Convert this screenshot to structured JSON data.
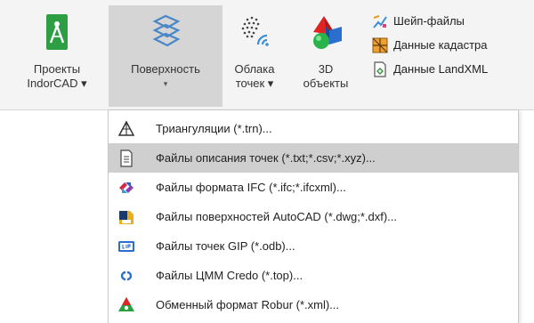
{
  "ribbon": {
    "projects": {
      "line1": "Проекты",
      "line2": "IndorCAD ▾",
      "icon": "compass-icon",
      "color": "#2e9e44"
    },
    "surface": {
      "line1": "Поверхность",
      "arrow": "▾",
      "icon": "layers-icon",
      "active": true
    },
    "cloud": {
      "line1": "Облака",
      "line2": "точек ▾",
      "icon": "point-cloud-icon"
    },
    "objects3d": {
      "line1": "3D",
      "line2": "объекты",
      "icon": "3d-shapes-icon"
    },
    "side_items": [
      {
        "label": "Шейп-файлы",
        "icon": "shapefile-icon"
      },
      {
        "label": "Данные кадастра",
        "icon": "cadastre-icon"
      },
      {
        "label": "Данные LandXML",
        "icon": "landxml-icon"
      }
    ]
  },
  "menu": {
    "items": [
      {
        "label": "Триангуляции (*.trn)...",
        "icon": "triangulation-icon",
        "highlighted": false
      },
      {
        "label": "Файлы описания точек (*.txt;*.csv;*.xyz)...",
        "icon": "text-file-icon",
        "highlighted": true
      },
      {
        "label": "Файлы формата IFC (*.ifc;*.ifcxml)...",
        "icon": "ifc-icon",
        "highlighted": false
      },
      {
        "label": "Файлы поверхностей AutoCAD (*.dwg;*.dxf)...",
        "icon": "autocad-icon",
        "highlighted": false
      },
      {
        "label": "Файлы точек GIP (*.odb)...",
        "icon": "gip-icon",
        "highlighted": false
      },
      {
        "label": "Файлы ЦММ Credo (*.top)...",
        "icon": "credo-icon",
        "highlighted": false
      },
      {
        "label": "Обменный формат Robur (*.xml)...",
        "icon": "robur-icon",
        "highlighted": false
      }
    ]
  },
  "colors": {
    "ribbon_bg": "#f4f4f4",
    "active_bg": "#d5d5d5",
    "menu_highlight": "#cfcfcf",
    "surface_icon": "#4a87c8"
  }
}
